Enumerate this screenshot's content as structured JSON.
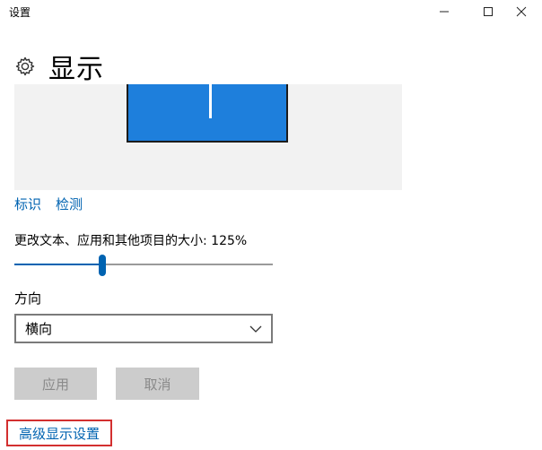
{
  "window": {
    "title": "设置",
    "controls": {
      "minimize_icon": "minimize-icon",
      "maximize_icon": "maximize-icon",
      "close_icon": "close-icon"
    }
  },
  "header": {
    "icon": "gear-icon",
    "title": "显示"
  },
  "display": {
    "monitor_color": "#1e7fdc"
  },
  "links": {
    "identify": "标识",
    "detect": "检测"
  },
  "scale": {
    "label": "更改文本、应用和其他项目的大小: 125%",
    "slider_fraction": 0.34
  },
  "orientation": {
    "label": "方向",
    "selected": "横向",
    "chevron_icon": "chevron-down-icon"
  },
  "buttons": {
    "apply": "应用",
    "cancel": "取消"
  },
  "advanced": {
    "label": "高级显示设置",
    "highlight_color": "#d32f2f"
  },
  "colors": {
    "accent": "#0063b1",
    "panel_bg": "#f2f2f2",
    "disabled_button_bg": "#cccccc"
  }
}
